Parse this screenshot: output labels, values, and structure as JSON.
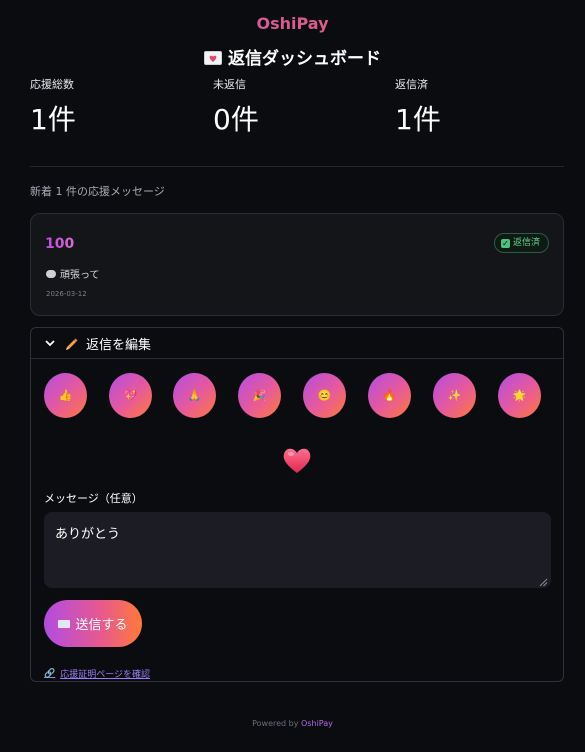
{
  "brand": "OshiPay",
  "page_title": "返信ダッシュボード",
  "stats": [
    {
      "label": "応援総数",
      "value": "1件"
    },
    {
      "label": "未返信",
      "value": "0件"
    },
    {
      "label": "返信済",
      "value": "1件"
    }
  ],
  "section_note": "新着 1 件の応援メッセージ",
  "message": {
    "amount": "100",
    "status": "返信済",
    "text": "頑張って",
    "date": "2026-03-12"
  },
  "editor": {
    "header": "返信を編集",
    "emojis": [
      {
        "icon": "thumbs-up-icon",
        "glyph": "👍"
      },
      {
        "icon": "heart-icon",
        "glyph": "💖"
      },
      {
        "icon": "pray-icon",
        "glyph": "🙏"
      },
      {
        "icon": "party-icon",
        "glyph": "🎉"
      },
      {
        "icon": "smile-icon",
        "glyph": "😊"
      },
      {
        "icon": "fire-icon",
        "glyph": "🔥"
      },
      {
        "icon": "sparkles-icon",
        "glyph": "✨"
      },
      {
        "icon": "star-icon",
        "glyph": "🌟"
      }
    ],
    "field_label": "メッセージ（任意）",
    "message_value": "ありがとう",
    "send_label": "送信する",
    "cert_link": "応援証明ページを確認"
  },
  "footer": {
    "prefix": "Powered by",
    "brand": "OshiPay"
  },
  "colors": {
    "background": "#0b0c10",
    "accent_start": "#b24de0",
    "accent_end": "#ff6a3d",
    "success": "#5fdc8f",
    "link": "#9b7cf5"
  }
}
